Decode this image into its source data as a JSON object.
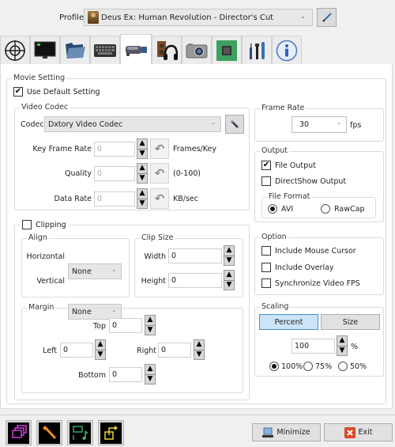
{
  "header": {
    "profile_label": "Profile",
    "profile_value": "Deus Ex: Human Revolution - Director's Cut",
    "edit_icon": "pencil-icon"
  },
  "tabs": [
    {
      "name": "capture-target",
      "icon": "crosshair-icon",
      "active": false
    },
    {
      "name": "overlay",
      "icon": "monitor-icon",
      "active": false
    },
    {
      "name": "folder",
      "icon": "folder-icon",
      "active": false
    },
    {
      "name": "hotkey",
      "icon": "keyboard-icon",
      "active": false
    },
    {
      "name": "movie",
      "icon": "camcorder-icon",
      "active": true
    },
    {
      "name": "audio",
      "icon": "speaker-headphones-icon",
      "active": false
    },
    {
      "name": "screenshot",
      "icon": "camera-icon",
      "active": false
    },
    {
      "name": "advanced",
      "icon": "chip-icon",
      "active": false
    },
    {
      "name": "tools",
      "icon": "tools-icon",
      "active": false
    },
    {
      "name": "info",
      "icon": "info-icon",
      "active": false
    }
  ],
  "movie": {
    "title": "Movie Setting",
    "use_default_label": "Use Default Setting",
    "use_default_checked": true,
    "video_codec": {
      "title": "Video Codec",
      "codec_label": "Codec",
      "codec_value": "Dxtory Video Codec",
      "key_frame_label": "Key Frame Rate",
      "key_frame_value": "0",
      "key_frame_unit": "Frames/Key",
      "quality_label": "Quality",
      "quality_value": "0",
      "quality_unit": "(0-100)",
      "data_rate_label": "Data Rate",
      "data_rate_value": "0",
      "data_rate_unit": "KB/sec"
    },
    "frame_rate": {
      "title": "Frame Rate",
      "value": "30",
      "unit": "fps"
    },
    "output": {
      "title": "Output",
      "file_output_label": "File Output",
      "file_output_checked": true,
      "directshow_label": "DirectShow Output",
      "directshow_checked": false,
      "file_format": {
        "title": "File Format",
        "options": [
          "AVI",
          "RawCap"
        ],
        "selected": "AVI"
      }
    },
    "clipping": {
      "label": "Clipping",
      "checked": false,
      "align": {
        "title": "Align",
        "horizontal_label": "Horizontal",
        "horizontal_value": "None",
        "vertical_label": "Vertical",
        "vertical_value": "None"
      },
      "clip_size": {
        "title": "Clip Size",
        "width_label": "Width",
        "width_value": "0",
        "height_label": "Height",
        "height_value": "0"
      },
      "margin": {
        "title": "Margin",
        "top_label": "Top",
        "top_value": "0",
        "left_label": "Left",
        "left_value": "0",
        "right_label": "Right",
        "right_value": "0",
        "bottom_label": "Bottom",
        "bottom_value": "0"
      }
    },
    "option": {
      "title": "Option",
      "items": [
        {
          "label": "Include Mouse Cursor",
          "checked": false
        },
        {
          "label": "Include Overlay",
          "checked": false
        },
        {
          "label": "Synchronize Video FPS",
          "checked": false
        }
      ]
    },
    "scaling": {
      "title": "Scaling",
      "percent_button": "Percent",
      "size_button": "Size",
      "selected_mode": "Percent",
      "value": "100",
      "unit": "%",
      "presets": [
        "100%",
        "75%",
        "50%"
      ],
      "selected_preset": "100%"
    }
  },
  "footer": {
    "icons": [
      "windows-stack-icon",
      "wrench-icon",
      "screen-audio-icon",
      "export-icon"
    ],
    "minimize_label": "Minimize",
    "exit_label": "Exit"
  }
}
